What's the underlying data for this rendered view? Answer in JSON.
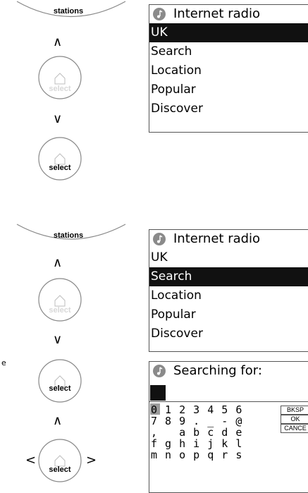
{
  "panel1": {
    "knob_label": "stations",
    "upper_button_label": "select",
    "lower_button_label": "select",
    "lcd_title": "Internet radio",
    "menu": [
      "UK",
      "Search",
      "Location",
      "Popular",
      "Discover"
    ],
    "selected_index": 0
  },
  "panel2": {
    "knob_label": "stations",
    "upper_button_label": "select",
    "middle_button_label": "select",
    "lower_button_label": "select",
    "lcd_title": "Internet radio",
    "menu": [
      "UK",
      "Search",
      "Location",
      "Popular",
      "Discover"
    ],
    "selected_index": 1,
    "search_title": "Searching for:",
    "keyboard_rows": [
      "0 1 2 3 4 5 6",
      "7 8 9 . _ - @",
      ",   a b c d e",
      "f g h i j k l",
      "m n o p q r s"
    ],
    "keyboard_buttons": [
      "BKSP",
      "OK",
      "CANCE"
    ],
    "left_char": "e"
  }
}
